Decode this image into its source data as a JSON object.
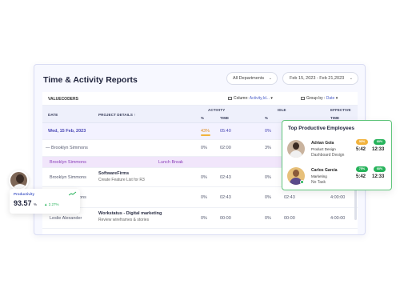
{
  "report": {
    "title": "Time & Activity Reports",
    "department": "All Departments",
    "date_range": "Feb 15, 2023 - Feb 21,2023",
    "company": "VALUECODERS",
    "column_label": "Column:",
    "column_value": "Activity,Id...",
    "group_label": "Group by :",
    "group_value": "Date"
  },
  "table": {
    "headers": {
      "date": "DATE",
      "project": "PROJECT DETAILS ↑",
      "activity": "ACTIVITY",
      "activity_pct": "%",
      "activity_time": "TIME",
      "idle": "IDLE",
      "idle_pct": "%",
      "effective": "EFFECTIVE",
      "effective_time": "TIME"
    },
    "date_row": {
      "date": "Wed, 15 Feb, 2023",
      "activity_pct": "43%",
      "activity_time": "05:40",
      "idle_pct": "0%"
    },
    "rows": [
      {
        "name": "Brooklyn Simmons",
        "project": "",
        "task": "",
        "act_pct": "0%",
        "act_time": "02:00",
        "idle_pct": "3%",
        "idle_time": "",
        "eff_time": ""
      },
      {
        "name": "Brooklyn Simmons",
        "project": "SoftwareFirms",
        "task": "Create Feature List for R3",
        "act_pct": "0%",
        "act_time": "02:43",
        "idle_pct": "0%",
        "idle_time": "",
        "eff_time": "00"
      },
      {
        "name": "Brooklyn Simmons",
        "project": "",
        "task": "",
        "act_pct": "0%",
        "act_time": "02:43",
        "idle_pct": "0%",
        "idle_time": "02:43",
        "eff_time": "4:00:00"
      },
      {
        "name": "Leslie Alexander",
        "project": "Workstatus - Digital marketing",
        "task": "Review wireframes & stories",
        "act_pct": "0%",
        "act_time": "00:00",
        "idle_pct": "0%",
        "idle_time": "00:00",
        "eff_time": "4:00:00"
      }
    ],
    "break_row": {
      "name": "Brooklyn Simmons",
      "label": "Lunch Break"
    }
  },
  "productive": {
    "title": "Top Productive Employees",
    "employees": [
      {
        "name": "Adrian Gola",
        "role": "Product Design",
        "task": "Dashboard Design",
        "pct1": "90%",
        "time1": "5:42",
        "pct2": "68%",
        "time2": "12:33"
      },
      {
        "name": "Carlos Garcia",
        "role": "Marketing",
        "task": "No Task",
        "pct1": "75%",
        "time1": "5:42",
        "pct2": "68%",
        "time2": "12:33"
      }
    ]
  },
  "metric": {
    "label": "Productivity",
    "value": "93.57",
    "unit": "%",
    "delta": "▲ 2.27%"
  },
  "colors": {
    "accent": "#4b5fc9",
    "green": "#27b35b",
    "orange": "#f2b33d",
    "break": "#f1e6fb"
  }
}
